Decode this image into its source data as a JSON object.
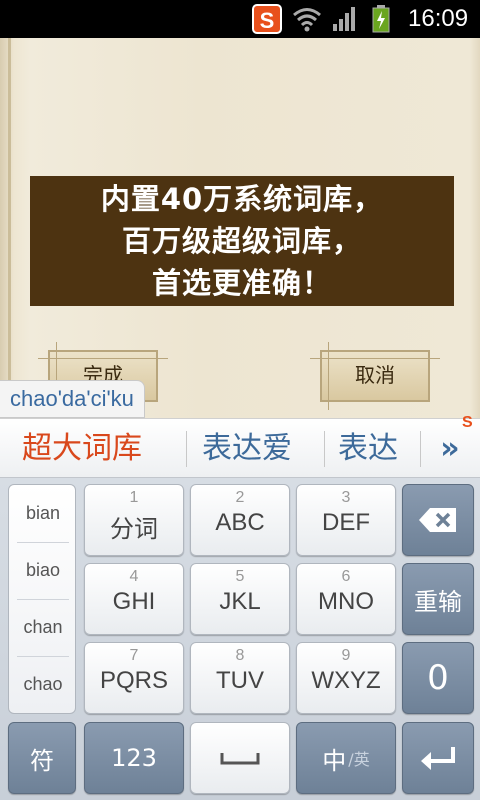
{
  "status_bar": {
    "time": "16:09",
    "app_icon_letter": "S",
    "icons": [
      "wifi-icon",
      "signal-icon",
      "battery-charging-icon"
    ]
  },
  "banner": {
    "lines": [
      "内置40万系统词库，",
      "百万级超级词库，",
      "首选更准确！"
    ]
  },
  "dialog": {
    "done_label": "完成",
    "cancel_label": "取消"
  },
  "ime": {
    "composing": "chao'da'ci'ku",
    "candidates": [
      "超大词库",
      "表达爱",
      "表达"
    ],
    "more_label": "»",
    "badge": "S",
    "pinyin_options": [
      "bian",
      "biao",
      "chan",
      "chao"
    ],
    "keys": [
      {
        "num": "1",
        "label": "分词"
      },
      {
        "num": "2",
        "label": "ABC"
      },
      {
        "num": "3",
        "label": "DEF"
      },
      {
        "num": "4",
        "label": "GHI"
      },
      {
        "num": "5",
        "label": "JKL"
      },
      {
        "num": "6",
        "label": "MNO"
      },
      {
        "num": "7",
        "label": "PQRS"
      },
      {
        "num": "8",
        "label": "TUV"
      },
      {
        "num": "9",
        "label": "WXYZ"
      }
    ],
    "reenter_label": "重输",
    "zero_label": "0",
    "symbol_label": "符",
    "numbers_label": "123",
    "lang_label": "中",
    "lang_sub": "/英"
  },
  "colors": {
    "accent_candidate": "#d9481c",
    "candidate": "#3d6a9a",
    "banner_bg": "#4d3311",
    "function_key": "#7d8fa5"
  }
}
